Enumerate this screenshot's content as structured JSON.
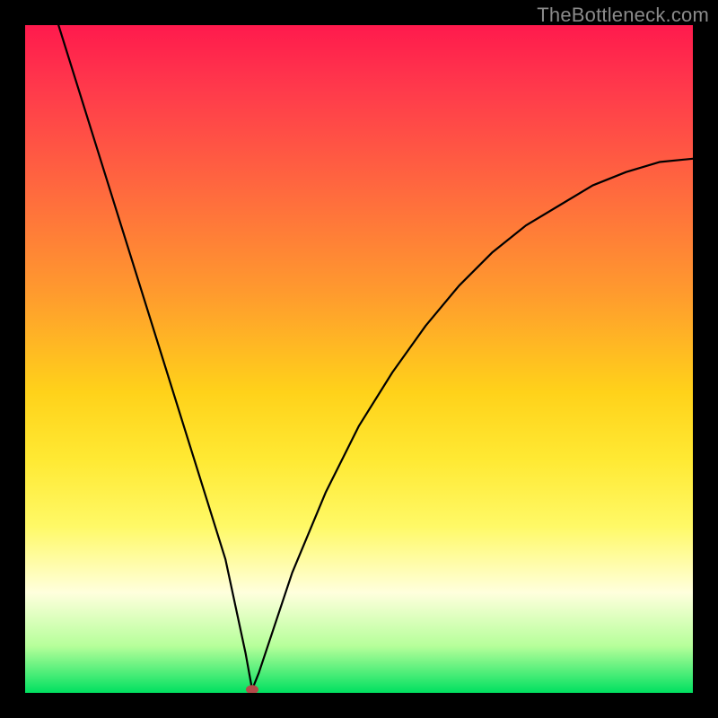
{
  "watermark": "TheBottleneck.com",
  "chart_data": {
    "type": "line",
    "title": "",
    "xlabel": "",
    "ylabel": "",
    "xlim": [
      0,
      100
    ],
    "ylim": [
      0,
      100
    ],
    "x": [
      5,
      10,
      15,
      20,
      25,
      30,
      33,
      34,
      35,
      40,
      45,
      50,
      55,
      60,
      65,
      70,
      75,
      80,
      85,
      90,
      95,
      100
    ],
    "y": [
      100,
      84,
      68,
      52,
      36,
      20,
      6,
      0.5,
      3,
      18,
      30,
      40,
      48,
      55,
      61,
      66,
      70,
      73,
      76,
      78,
      79.5,
      80
    ],
    "marker": {
      "x": 34,
      "y": 0.5
    },
    "colormap": "RdYlGn_r"
  }
}
